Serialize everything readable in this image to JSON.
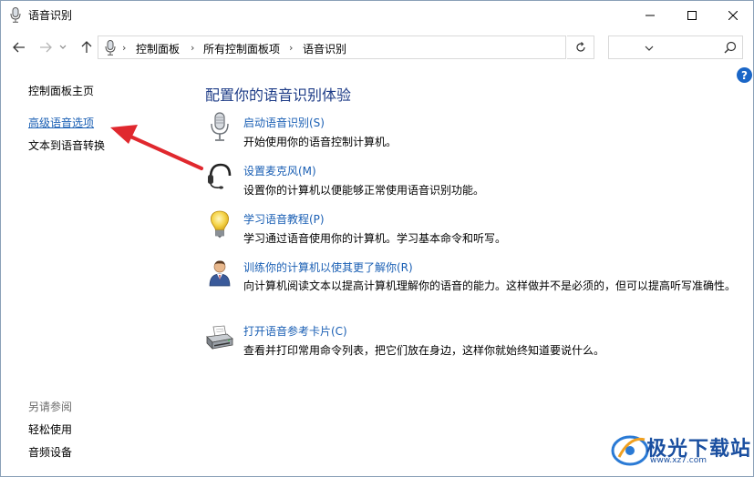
{
  "window": {
    "title": "语音识别",
    "icon": "microphone-icon"
  },
  "address": {
    "crumbs": [
      "控制面板",
      "所有控制面板项",
      "语音识别"
    ],
    "separator": "›",
    "search_placeholder": ""
  },
  "sidebar": {
    "items": [
      {
        "label": "控制面板主页"
      },
      {
        "label": "高级语音选项"
      },
      {
        "label": "文本到语音转换"
      }
    ],
    "see_also_label": "另请参阅",
    "see_also": [
      {
        "label": "轻松使用"
      },
      {
        "label": "音频设备"
      }
    ]
  },
  "main": {
    "title": "配置你的语音识别体验",
    "tasks": [
      {
        "link": "启动语音识别(S)",
        "desc": "开始使用你的语音控制计算机。",
        "icon": "microphone-icon"
      },
      {
        "link": "设置麦克风(M)",
        "desc": "设置你的计算机以便能够正常使用语音识别功能。",
        "icon": "headset-icon"
      },
      {
        "link": "学习语音教程(P)",
        "desc": "学习通过语音使用你的计算机。学习基本命令和听写。",
        "icon": "lightbulb-icon"
      },
      {
        "link": "训练你的计算机以使其更了解你(R)",
        "desc": "向计算机阅读文本以提高计算机理解你的语音的能力。这样做并不是必须的，但可以提高听写准确性。",
        "icon": "user-icon"
      },
      {
        "link": "打开语音参考卡片(C)",
        "desc": "查看并打印常用命令列表，把它们放在身边，这样你就始终知道要说什么。",
        "icon": "printer-icon"
      }
    ]
  },
  "watermark": {
    "text": "极光下载站",
    "sub": "www.xz7.com"
  },
  "colors": {
    "link": "#1a5fb4",
    "title": "#1e3c87",
    "arrow": "#e0282e"
  }
}
